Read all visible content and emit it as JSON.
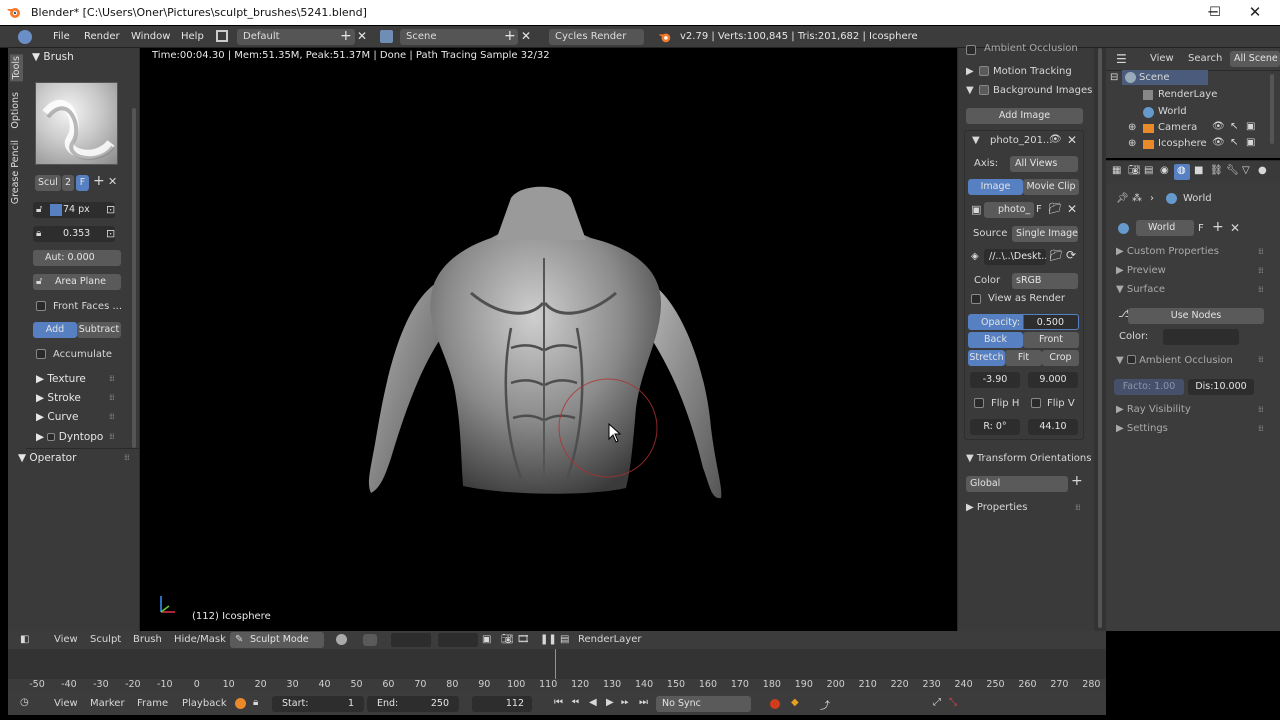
{
  "window": {
    "title": "Blender* [C:\\Users\\Oner\\Pictures\\sculpt_brushes\\5241.blend]",
    "minimize": "─",
    "maximize": "☐",
    "close": "✕"
  },
  "info_header": {
    "menus": [
      "File",
      "Render",
      "Window",
      "Help"
    ],
    "layout": "Default",
    "scene": "Scene",
    "engine": "Cycles Render",
    "stats": "v2.79 | Verts:100,845 | Tris:201,682 | Icosphere"
  },
  "tool_tabs": [
    "Tools",
    "Options",
    "Grease Pencil"
  ],
  "brush_panel": {
    "title": "Brush",
    "brush_name": "Scul",
    "users": "2",
    "fake": "F",
    "radius": "74 px",
    "strength": "0.353",
    "autosmooth": "Aut: 0.000",
    "sculpt_plane": "Area Plane",
    "front_faces": "Front Faces ...",
    "add_label": "Add",
    "subtract_label": "Subtract",
    "accumulate": "Accumulate",
    "subpanels": [
      "Texture",
      "Stroke",
      "Curve",
      "Dyntopo"
    ],
    "operator": "Operator"
  },
  "viewport": {
    "status": "Time:00:04.30 | Mem:51.35M, Peak:51.37M | Done | Path Tracing Sample 32/32",
    "object_label": "(112) Icosphere"
  },
  "properties_shelf": {
    "ambient_occlusion": "Ambient Occlusion",
    "motion_tracking": "Motion Tracking",
    "background_images": "Background Images",
    "add_image": "Add Image",
    "image_name": "photo_201...",
    "axis_label": "Axis:",
    "axis_value": "All Views",
    "tab_image": "Image",
    "tab_movie": "Movie Clip",
    "image_field": "photo_",
    "image_field_f": "F",
    "source_label": "Source",
    "source_value": "Single Image",
    "path": "//..\\..\\Deskt...",
    "color_label": "Color",
    "color_value": "sRGB",
    "view_as_render": "View as Render",
    "opacity_label": "Opacity:",
    "opacity_value": "0.500",
    "back": "Back",
    "front": "Front",
    "stretch": "Stretch",
    "fit": "Fit",
    "crop": "Crop",
    "offset_x": "-3.90",
    "offset_y": "9.000",
    "flip_h": "Flip H",
    "flip_v": "Flip V",
    "rotation": "R: 0°",
    "size": "44.10",
    "transform_orientations": "Transform Orientations",
    "orientation_value": "Global",
    "properties": "Properties"
  },
  "outliner": {
    "view": "View",
    "search": "Search",
    "filter": "All Scene",
    "items": [
      "Scene",
      "RenderLaye",
      "World",
      "Camera",
      "Icosphere"
    ]
  },
  "properties_editor": {
    "context": "World",
    "world_field": "World",
    "world_f": "F",
    "sections": {
      "custom_properties": "Custom Properties",
      "preview": "Preview",
      "surface": "Surface",
      "use_nodes": "Use Nodes",
      "color_label": "Color:",
      "ambient_occlusion": "Ambient Occlusion",
      "factor": "Facto: 1.00",
      "distance": "Dis:10.000",
      "ray_visibility": "Ray Visibility",
      "settings": "Settings"
    }
  },
  "sculpt_header": {
    "menus": [
      "View",
      "Sculpt",
      "Brush",
      "Hide/Mask"
    ],
    "mode": "Sculpt Mode",
    "render_layer": "RenderLayer"
  },
  "timeline": {
    "ticks": [
      "-50",
      "-40",
      "-30",
      "-20",
      "-10",
      "0",
      "10",
      "20",
      "30",
      "40",
      "50",
      "60",
      "70",
      "80",
      "90",
      "100",
      "110",
      "120",
      "130",
      "140",
      "150",
      "160",
      "170",
      "180",
      "190",
      "200",
      "210",
      "220",
      "230",
      "240",
      "250",
      "260",
      "270",
      "280"
    ],
    "current_frame": 112,
    "menus": [
      "View",
      "Marker",
      "Frame",
      "Playback"
    ],
    "start": "Start:",
    "start_value": "1",
    "end": "End:",
    "end_value": "250",
    "frame": "112",
    "sync": "No Sync"
  },
  "colors": {
    "panel": "#3a3a3a",
    "header": "#3c3c3c",
    "active_blue": "#5680c2",
    "brush_cursor": "#b03030"
  }
}
